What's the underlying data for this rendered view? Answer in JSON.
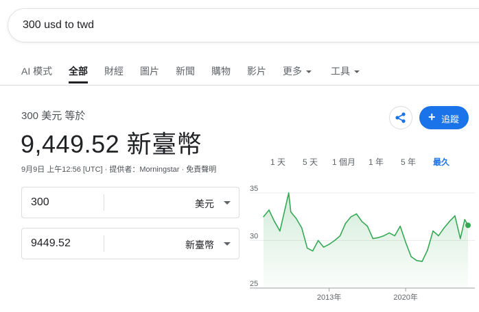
{
  "search": {
    "query": "300 usd to twd"
  },
  "tabs": [
    {
      "label": "AI 模式"
    },
    {
      "label": "全部"
    },
    {
      "label": "財經"
    },
    {
      "label": "圖片"
    },
    {
      "label": "新聞"
    },
    {
      "label": "購物"
    },
    {
      "label": "影片"
    },
    {
      "label": "更多"
    },
    {
      "label": "工具"
    }
  ],
  "converter": {
    "equivalence": "300 美元 等於",
    "result": "9,449.52 新臺幣",
    "meta": "9月9日 上午12:56 [UTC] · 提供者：Morningstar · 免責聲明",
    "from": {
      "value": "300",
      "unit": "美元"
    },
    "to": {
      "value": "9449.52",
      "unit": "新臺幣"
    }
  },
  "actions": {
    "follow_label": "追蹤"
  },
  "ranges": [
    {
      "label": "1 天"
    },
    {
      "label": "5 天"
    },
    {
      "label": "1 個月"
    },
    {
      "label": "1 年"
    },
    {
      "label": "5 年"
    },
    {
      "label": "最久"
    }
  ],
  "colors": {
    "accent": "#1a73e8",
    "line": "#34a853",
    "fill": "#e6f4ea"
  },
  "chart_data": {
    "type": "area",
    "yticks": [
      35,
      30,
      25
    ],
    "ylim": [
      25,
      35
    ],
    "xticks": [
      {
        "label": "2013年",
        "x": 2013
      },
      {
        "label": "2020年",
        "x": 2020
      }
    ],
    "x": [
      2007.0,
      2007.5,
      2008.0,
      2008.5,
      2009.0,
      2009.3,
      2009.5,
      2010.0,
      2010.5,
      2011.0,
      2011.5,
      2012.0,
      2012.5,
      2013.0,
      2013.5,
      2014.0,
      2014.5,
      2015.0,
      2015.5,
      2016.0,
      2016.5,
      2017.0,
      2017.5,
      2018.0,
      2018.5,
      2019.0,
      2019.5,
      2020.0,
      2020.5,
      2021.0,
      2021.5,
      2022.0,
      2022.5,
      2023.0,
      2023.5,
      2024.0,
      2024.5,
      2025.0,
      2025.4,
      2025.7
    ],
    "y": [
      32.5,
      33.2,
      32.0,
      31.0,
      33.5,
      35.0,
      33.0,
      32.3,
      31.3,
      29.2,
      28.9,
      30.0,
      29.3,
      29.6,
      30.0,
      30.5,
      31.8,
      32.5,
      32.8,
      32.0,
      31.5,
      30.2,
      30.3,
      30.5,
      30.8,
      30.5,
      31.5,
      29.8,
      28.3,
      27.9,
      27.8,
      29.0,
      31.0,
      30.5,
      31.3,
      32.0,
      32.6,
      30.2,
      32.2,
      31.6
    ]
  }
}
